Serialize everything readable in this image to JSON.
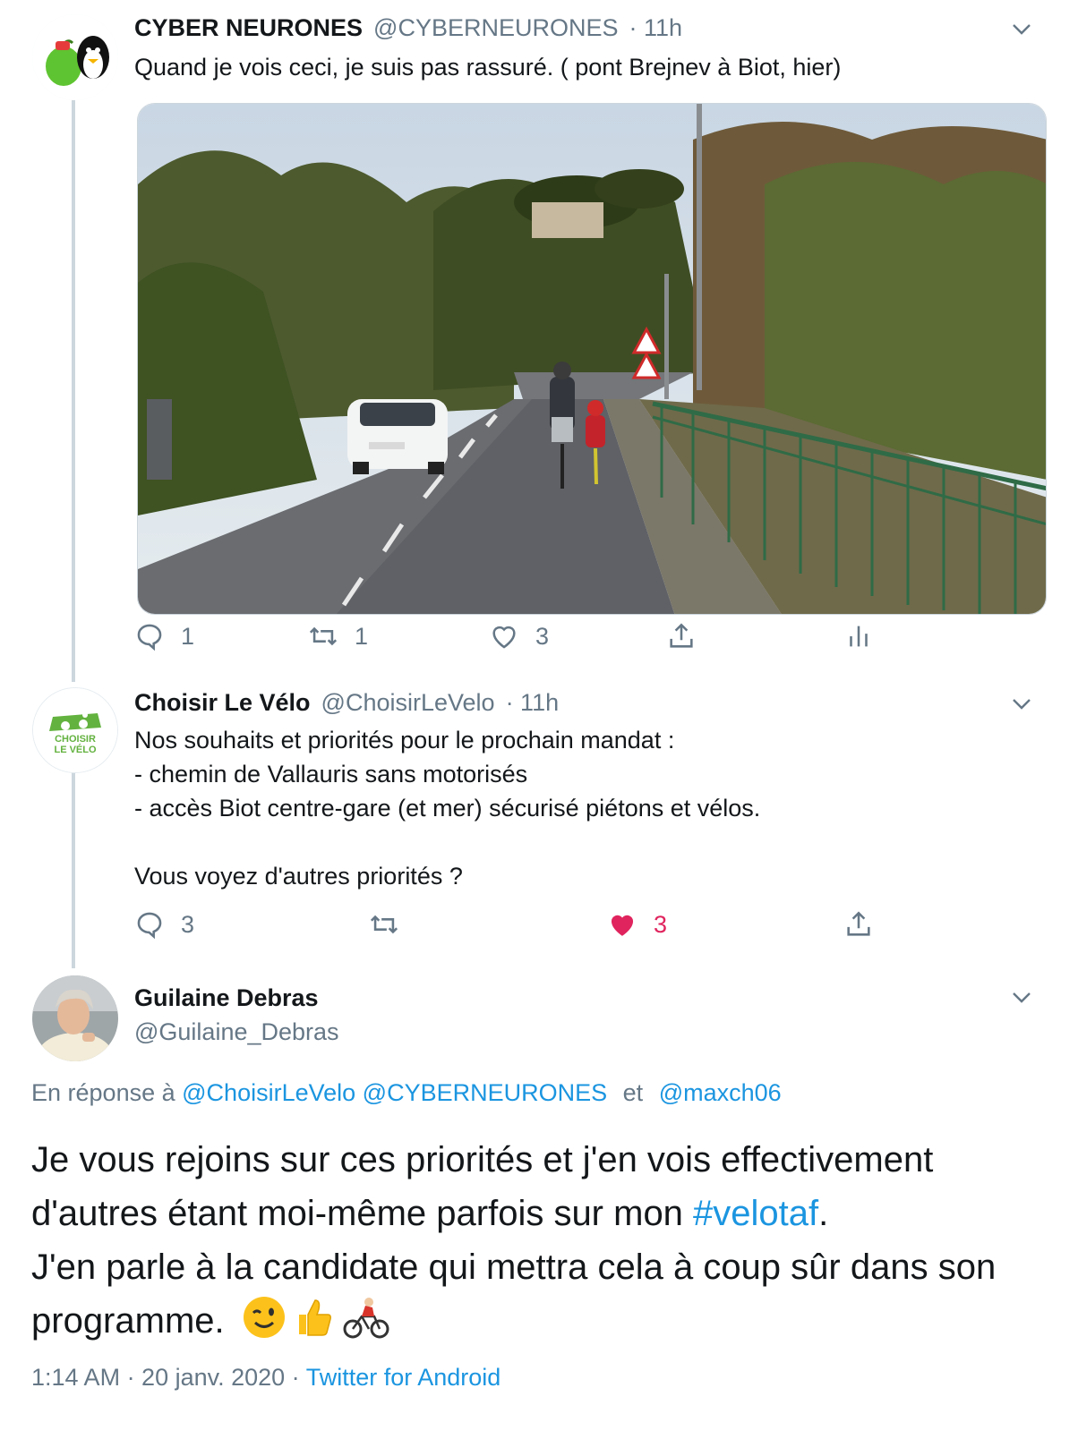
{
  "tweets": [
    {
      "name": "CYBER NEURONES",
      "handle": "@CYBERNEURONES",
      "time": "· 11h",
      "text": "Quand je vois ceci, je suis pas rassuré. ( pont Brejnev à Biot, hier)",
      "actions": {
        "reply_count": "1",
        "retweet_count": "1",
        "like_count": "3"
      }
    },
    {
      "name": "Choisir Le Vélo",
      "handle": "@ChoisirLeVelo",
      "time": "· 11h",
      "avatar_text_1": "CHOISIR",
      "avatar_text_2": "LE VÉLO",
      "lines": [
        "Nos souhaits et priorités pour le prochain mandat :",
        "- chemin de Vallauris sans motorisés",
        "- accès Biot centre-gare (et mer) sécurisé piétons et vélos.",
        "Vous voyez d'autres priorités ?"
      ],
      "actions": {
        "reply_count": "3",
        "like_count": "3"
      }
    }
  ],
  "main_tweet": {
    "name": "Guilaine Debras",
    "handle": "@Guilaine_Debras",
    "reply_prefix": "En réponse à",
    "reply_to_1": "@ChoisirLeVelo",
    "reply_to_2": "@CYBERNEURONES",
    "reply_and": "et",
    "reply_to_3": "@maxch06",
    "text_1": "Je vous rejoins sur ces priorités et j'en vois effectivement d'autres étant moi-même parfois sur mon ",
    "hashtag": "#velotaf",
    "text_2": ".",
    "text_3": "J'en parle à la candidate qui mettra cela à coup sûr dans son programme.",
    "emojis": [
      "winking-face",
      "thumbs-up",
      "person-biking"
    ],
    "timestamp": "1:14 AM · 20 janv. 2020 ·",
    "source": "Twitter for Android"
  },
  "colors": {
    "accent": "#1b95e0",
    "liked": "#e0245e",
    "muted": "#657786",
    "thread": "#ccd6dd"
  }
}
